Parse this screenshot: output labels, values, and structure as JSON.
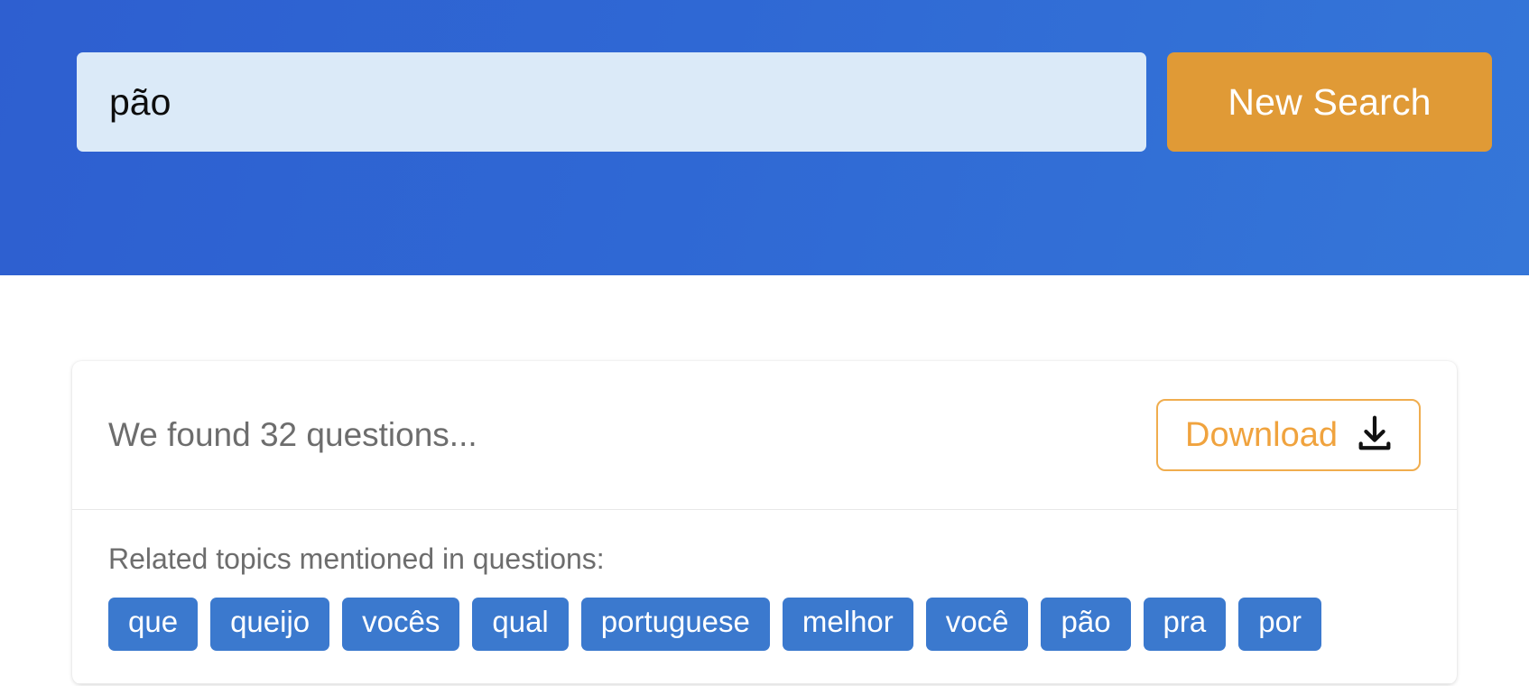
{
  "header": {
    "search": {
      "value": "pão",
      "placeholder": "Enter a keyword"
    },
    "new_search_label": "New Search",
    "accent_blue": "#2f68d4",
    "accent_orange": "#e09a36"
  },
  "results": {
    "found_text": "We found 32 questions...",
    "question_count": 32,
    "download_label": "Download",
    "download_icon": "download-icon",
    "topics_label": "Related topics mentioned in questions:",
    "topics": [
      "que",
      "queijo",
      "vocês",
      "qual",
      "portuguese",
      "melhor",
      "você",
      "pão",
      "pra",
      "por"
    ],
    "tag_color": "#3b79ce",
    "download_border_color": "#f0ad4e",
    "muted_text_color": "#6d6d6d"
  }
}
